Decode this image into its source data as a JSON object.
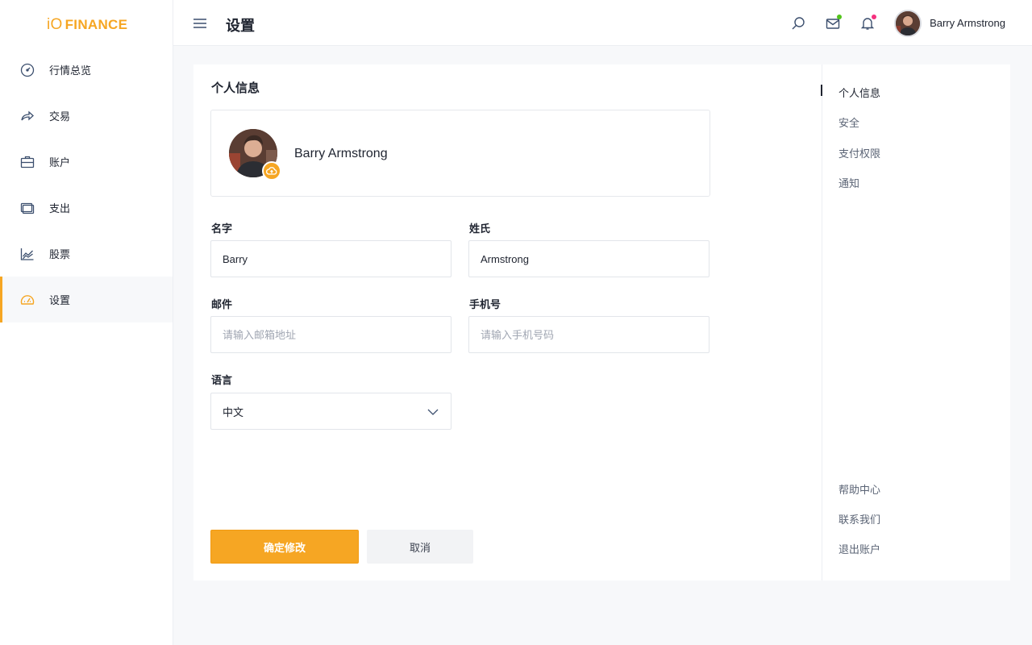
{
  "brand": {
    "prefix": "iO",
    "name": "FINANCE",
    "accent": "#f6a623"
  },
  "sidebar": {
    "items": [
      {
        "label": "行情总览",
        "icon": "speedometer-icon",
        "active": false
      },
      {
        "label": "交易",
        "icon": "share-arrow-icon",
        "active": false
      },
      {
        "label": "账户",
        "icon": "briefcase-icon",
        "active": false
      },
      {
        "label": "支出",
        "icon": "wallet-icon",
        "active": false
      },
      {
        "label": "股票",
        "icon": "stock-chart-icon",
        "active": false
      },
      {
        "label": "设置",
        "icon": "gauge-icon",
        "active": true
      }
    ]
  },
  "header": {
    "title": "设置",
    "user_name": "Barry Armstrong",
    "icons": [
      "search-icon",
      "mail-icon",
      "bell-icon"
    ],
    "mail_dot_color": "#52c41a",
    "bell_dot_color": "#f5317f"
  },
  "profile": {
    "section_title": "个人信息",
    "name": "Barry Armstrong"
  },
  "form": {
    "first_name_label": "名字",
    "first_name_value": "Barry",
    "last_name_label": "姓氏",
    "last_name_value": "Armstrong",
    "email_label": "邮件",
    "email_placeholder": "请输入邮箱地址",
    "phone_label": "手机号",
    "phone_placeholder": "请输入手机号码",
    "language_label": "语言",
    "language_value": "中文",
    "confirm_label": "确定修改",
    "cancel_label": "取消"
  },
  "right_panel": {
    "items": [
      {
        "label": "个人信息",
        "active": true
      },
      {
        "label": "安全",
        "active": false
      },
      {
        "label": "支付权限",
        "active": false
      },
      {
        "label": "通知",
        "active": false
      }
    ],
    "footer_items": [
      {
        "label": "帮助中心"
      },
      {
        "label": "联系我们"
      },
      {
        "label": "退出账户"
      }
    ]
  }
}
